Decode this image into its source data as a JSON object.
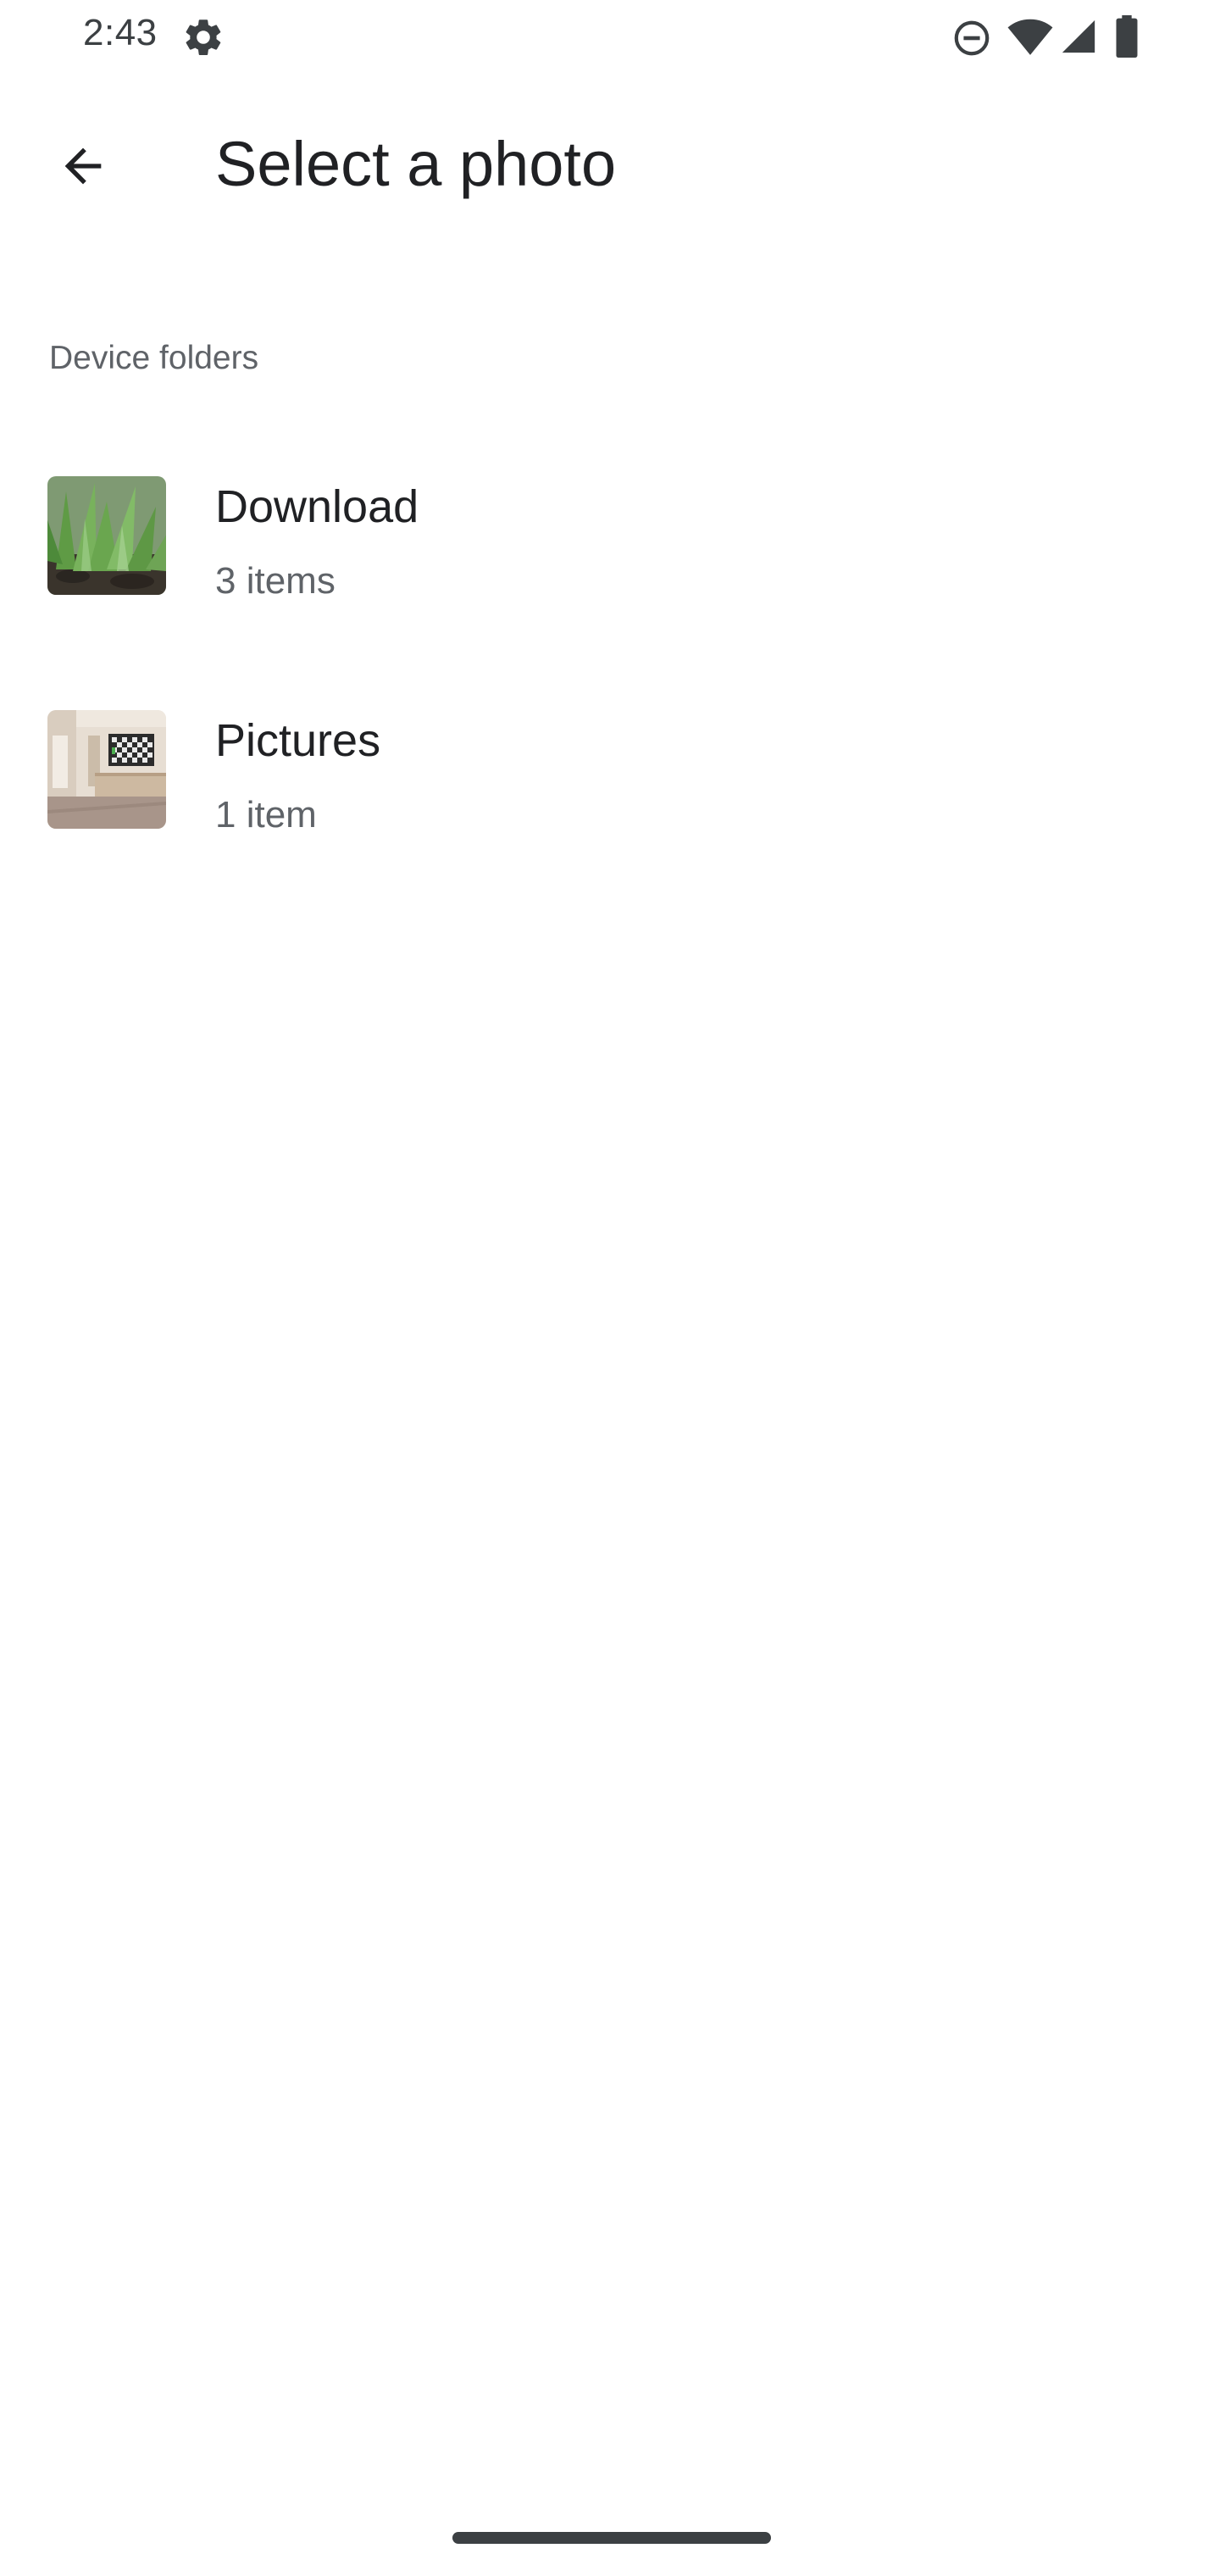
{
  "status_bar": {
    "time": "2:43",
    "icons": [
      "gear-icon",
      "do-not-disturb-icon",
      "wifi-icon",
      "cell-signal-icon",
      "battery-icon"
    ]
  },
  "app_bar": {
    "back_icon": "arrow-back-icon",
    "title": "Select a photo"
  },
  "section": {
    "header": "Device folders"
  },
  "folders": [
    {
      "name": "Download",
      "count": "3 items",
      "thumbnail": "aloe-plant-photo"
    },
    {
      "name": "Pictures",
      "count": "1 item",
      "thumbnail": "room-interior-photo"
    }
  ],
  "colors": {
    "background": "#ffffff",
    "title_text": "#202124",
    "secondary_text": "#5f6368",
    "icon": "#3c4043"
  }
}
